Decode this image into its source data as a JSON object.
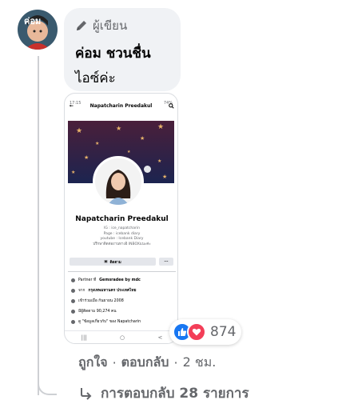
{
  "comment": {
    "badge_label": "ผู้เขียน",
    "author": "ค่อม ชวนชื่น",
    "text": "ไอซ์ค่ะ"
  },
  "attachment": {
    "time": "17:15",
    "battery": "74%",
    "profile_name_header": "Napatcharin Preedakul",
    "profile_name": "Napatcharin Preedakul",
    "bio_lines": [
      "IG : ice_napatcharin",
      "Page : icebank diary",
      "youtube : Icebank  Diary",
      "ปรึกษาติดต่องานทางอิ INBOXแนะค่ะ"
    ],
    "follow_button": "ติดตาม",
    "more_button": "···",
    "info": [
      {
        "prefix": "Partner ที่ ",
        "bold": "Gemsradee by mdc"
      },
      {
        "prefix": "จาก ",
        "bold": "กรุงเทพมหานคร ประเทศไทย"
      },
      {
        "prefix": "เข้าร่วมเมื่อ กันยายน 2008",
        "bold": ""
      },
      {
        "prefix": "มีผู้ติดตาม 90,274 คน",
        "bold": ""
      },
      {
        "prefix": "ดู \"ข้อมูลเกี่ยวกับ\" ของ Napatcharin",
        "bold": ""
      }
    ],
    "nav": [
      "|||",
      "○",
      "<"
    ]
  },
  "reactions": {
    "count": "874",
    "icons": [
      "like-icon",
      "love-icon"
    ],
    "colors": {
      "like": "#1877f2",
      "love": "#f33e58"
    }
  },
  "actions": {
    "like": "ถูกใจ",
    "reply": "ตอบกลับ",
    "time": "2 ชม.",
    "sep": "·"
  },
  "replies": {
    "label": "การตอบกลับ 28 รายการ"
  }
}
